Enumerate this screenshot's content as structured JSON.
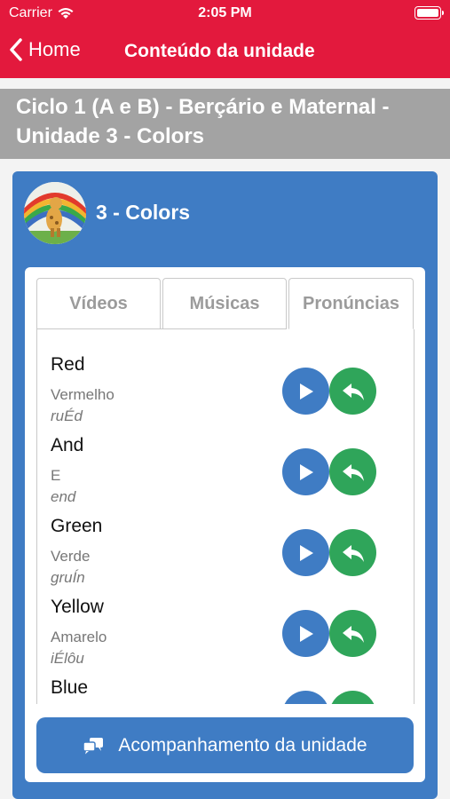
{
  "status_bar": {
    "carrier": "Carrier",
    "time": "2:05 PM"
  },
  "nav": {
    "back_label": "Home",
    "title": "Conteúdo da unidade"
  },
  "unit_header": {
    "title": "Ciclo 1 (A e B) - Berçário e Maternal - Unidade 3 - Colors"
  },
  "card": {
    "title": "3 - Colors"
  },
  "tabs": [
    {
      "label": "Vídeos",
      "active": false
    },
    {
      "label": "Músicas",
      "active": false
    },
    {
      "label": "Pronúncias",
      "active": true
    }
  ],
  "words": [
    {
      "word": "Red",
      "translation": "Vermelho",
      "pronunciation": "ruÉd"
    },
    {
      "word": "And",
      "translation": "E",
      "pronunciation": "end"
    },
    {
      "word": "Green",
      "translation": "Verde",
      "pronunciation": "gruÍn"
    },
    {
      "word": "Yellow",
      "translation": "Amarelo",
      "pronunciation": "iÉlôu"
    },
    {
      "word": "Blue",
      "translation": "",
      "pronunciation": ""
    }
  ],
  "follow_button": {
    "label": "Acompanhamento da unidade"
  },
  "colors": {
    "brand_red": "#e3193d",
    "primary_blue": "#3f7cc4",
    "record_green": "#2fa55a",
    "header_gray": "#a3a3a3"
  },
  "icons": [
    "wifi-icon",
    "battery-icon",
    "chevron-left-icon",
    "play-icon",
    "record-reply-icon",
    "chat-icon"
  ]
}
